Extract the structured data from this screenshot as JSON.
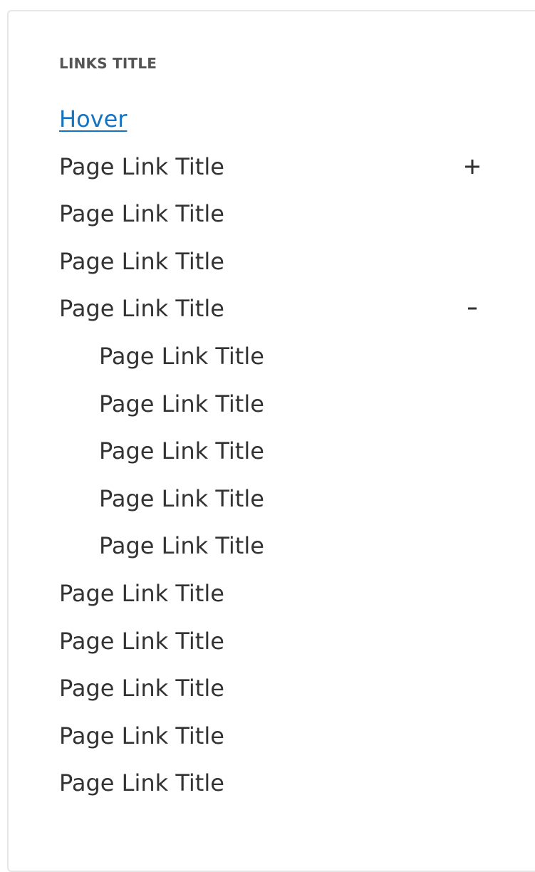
{
  "links_title": "LINKS TITLE",
  "links": [
    {
      "label": "Hover",
      "level": 0,
      "state": "hover"
    },
    {
      "label": "Page Link Title",
      "level": 0,
      "toggle_icon": "plus-icon"
    },
    {
      "label": "Page Link Title",
      "level": 0
    },
    {
      "label": "Page Link Title",
      "level": 0
    },
    {
      "label": "Page Link Title",
      "level": 0,
      "toggle_icon": "minus-icon"
    },
    {
      "label": "Page Link Title",
      "level": 1
    },
    {
      "label": "Page Link Title",
      "level": 1
    },
    {
      "label": "Page Link Title",
      "level": 1
    },
    {
      "label": "Page Link Title",
      "level": 1
    },
    {
      "label": "Page Link Title",
      "level": 1
    },
    {
      "label": "Page Link Title",
      "level": 0
    },
    {
      "label": "Page Link Title",
      "level": 0
    },
    {
      "label": "Page Link Title",
      "level": 0
    },
    {
      "label": "Page Link Title",
      "level": 0
    },
    {
      "label": "Page Link Title",
      "level": 0
    }
  ],
  "colors": {
    "link_hover": "#1573c0",
    "text": "#333333",
    "title": "#555555",
    "border": "#e6e6e6"
  }
}
